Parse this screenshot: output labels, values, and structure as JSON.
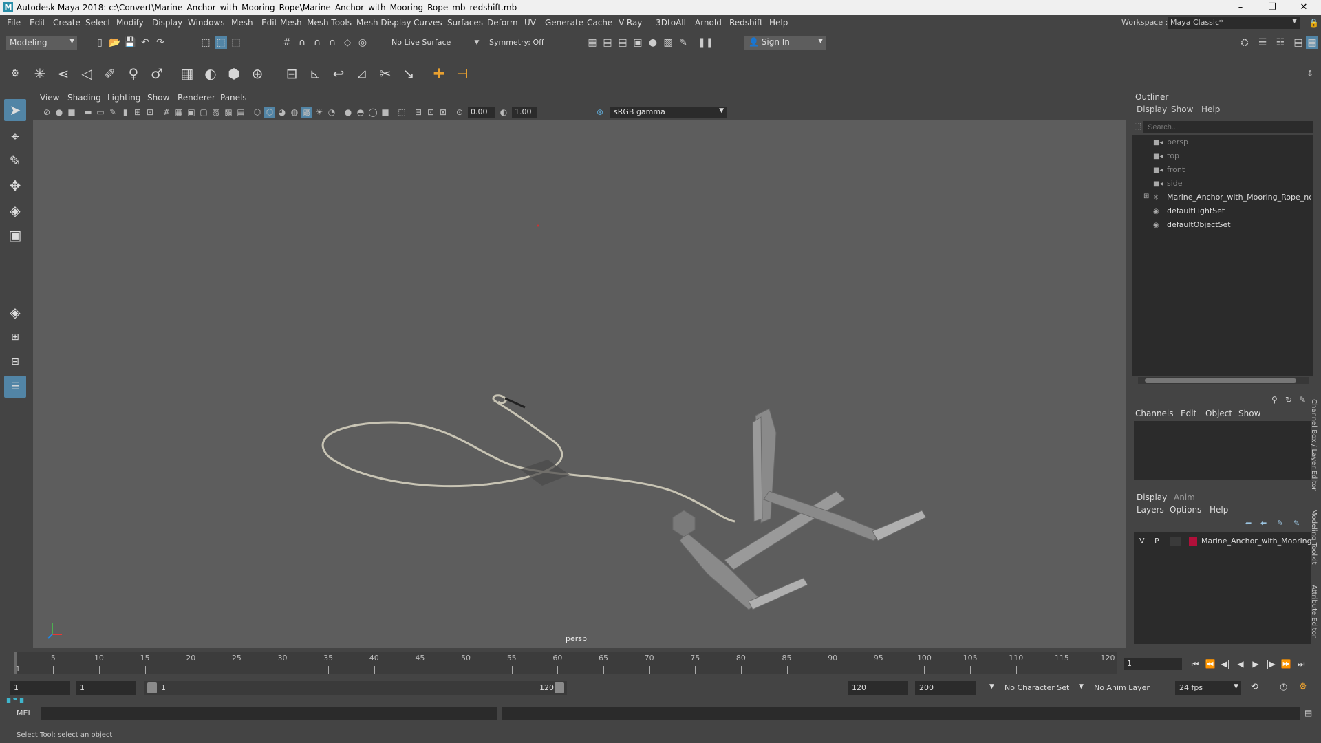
{
  "window": {
    "app_logo": "M",
    "title": "Autodesk Maya 2018: c:\\Convert\\Marine_Anchor_with_Mooring_Rope\\Marine_Anchor_with_Mooring_Rope_mb_redshift.mb",
    "minimize": "–",
    "maximize": "❐",
    "close": "✕"
  },
  "menubar": {
    "items": [
      "File",
      "Edit",
      "Create",
      "Select",
      "Modify",
      "Display",
      "Windows",
      "Mesh",
      "Edit Mesh",
      "Mesh Tools",
      "Mesh Display",
      "Curves",
      "Surfaces",
      "Deform",
      "UV",
      "Generate",
      "Cache",
      "V-Ray",
      "- 3DtoAll -",
      "Arnold",
      "Redshift",
      "Help"
    ],
    "workspace_label": "Workspace :",
    "workspace_value": "Maya Classic*"
  },
  "statusline": {
    "mode": "Modeling",
    "live_surface": "No Live Surface",
    "symmetry": "Symmetry: Off",
    "sign_in": "Sign In"
  },
  "viewport": {
    "menu": [
      "View",
      "Shading",
      "Lighting",
      "Show",
      "Renderer",
      "Panels"
    ],
    "exposure": "0.00",
    "gamma": "1.00",
    "color_space": "sRGB gamma",
    "camera": "persp"
  },
  "outliner": {
    "title": "Outliner",
    "menu": [
      "Display",
      "Show",
      "Help"
    ],
    "search_placeholder": "Search...",
    "items": [
      {
        "label": "persp",
        "icon": "camera-icon",
        "style": "dim"
      },
      {
        "label": "top",
        "icon": "camera-icon",
        "style": "dim"
      },
      {
        "label": "front",
        "icon": "camera-icon",
        "style": "dim"
      },
      {
        "label": "side",
        "icon": "camera-icon",
        "style": "dim"
      },
      {
        "label": "Marine_Anchor_with_Mooring_Rope_nc",
        "icon": "group-icon",
        "style": "bright"
      },
      {
        "label": "defaultLightSet",
        "icon": "set-icon",
        "style": "bright"
      },
      {
        "label": "defaultObjectSet",
        "icon": "set-icon",
        "style": "bright"
      }
    ]
  },
  "channelbox": {
    "menu": [
      "Channels",
      "Edit",
      "Object",
      "Show"
    ],
    "tabs": [
      "Display",
      "Anim"
    ],
    "layer_menu": [
      "Layers",
      "Options",
      "Help"
    ],
    "layer": {
      "v": "V",
      "p": "P",
      "name": "Marine_Anchor_with_Mooring",
      "color": "#b0103a"
    },
    "side_tabs": [
      "Channel Box / Layer Editor",
      "Modeling Toolkit",
      "Attribute Editor"
    ]
  },
  "timeslider": {
    "ticks": [
      1,
      5,
      10,
      15,
      20,
      25,
      30,
      35,
      40,
      45,
      50,
      55,
      60,
      65,
      70,
      75,
      80,
      85,
      90,
      95,
      100,
      105,
      110,
      115,
      120
    ],
    "current_frame_label": "1",
    "current_frame": "1"
  },
  "rangeslider": {
    "start": "1",
    "anim_start": "1",
    "range_start": "1",
    "range_end": "120",
    "playback_end": "120",
    "anim_end": "200",
    "character_set": "No Character Set",
    "anim_layer": "No Anim Layer",
    "fps": "24 fps"
  },
  "commandline": {
    "label": "MEL"
  },
  "helpline": {
    "text": "Select Tool: select an object"
  },
  "colors": {
    "accent": "#5285a6",
    "viewport_bg": "#5d5d5d",
    "panel_bg": "#444444",
    "field_bg": "#2b2b2b"
  }
}
